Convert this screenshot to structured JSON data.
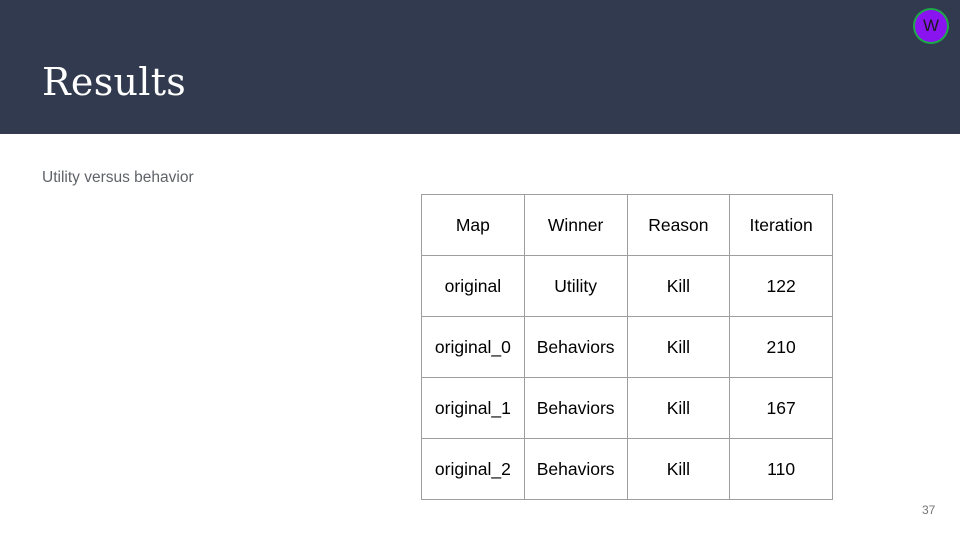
{
  "slide": {
    "title": "Results",
    "subtitle": "Utility versus behavior",
    "page_number": "37"
  },
  "avatar": {
    "initial": "W",
    "color": "#8a14f0",
    "ring_color": "#1ea84a"
  },
  "theme": {
    "header_color": "#313a4e"
  },
  "table": {
    "headers": [
      "Map",
      "Winner",
      "Reason",
      "Iteration"
    ],
    "rows": [
      [
        "original",
        "Utility",
        "Kill",
        "122"
      ],
      [
        "original_0",
        "Behaviors",
        "Kill",
        "210"
      ],
      [
        "original_1",
        "Behaviors",
        "Kill",
        "167"
      ],
      [
        "original_2",
        "Behaviors",
        "Kill",
        "110"
      ]
    ]
  }
}
